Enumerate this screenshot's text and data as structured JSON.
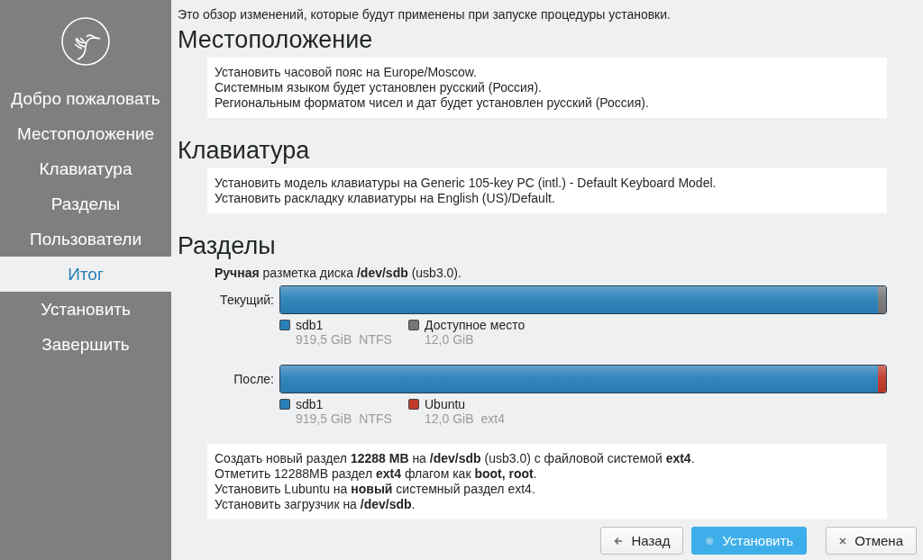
{
  "sidebar": {
    "items": [
      {
        "label": "Добро пожаловать",
        "selected": false
      },
      {
        "label": "Местоположение",
        "selected": false
      },
      {
        "label": "Клавиатура",
        "selected": false
      },
      {
        "label": "Разделы",
        "selected": false
      },
      {
        "label": "Пользователи",
        "selected": false
      },
      {
        "label": "Итог",
        "selected": true
      },
      {
        "label": "Установить",
        "selected": false
      },
      {
        "label": "Завершить",
        "selected": false
      }
    ]
  },
  "intro": "Это обзор изменений, которые будут применены при запуске процедуры установки.",
  "sections": [
    {
      "kind": "text",
      "title": "Местоположение",
      "lines": [
        "Установить часовой пояс на Europe/Moscow.",
        "Системным языком будет установлен русский (Россия).",
        "Региональным форматом чисел и дат будет установлен русский (Россия)."
      ]
    },
    {
      "kind": "text",
      "title": "Клавиатура",
      "lines": [
        "Установить модель клавиатуры на Generic 105-key PC (intl.) - Default Keyboard Model.",
        "Установить раскладку клавиатуры на English (US)/Default."
      ]
    },
    {
      "kind": "partitions",
      "title": "Разделы",
      "description": "**Ручная** разметка диска **/dev/sdb** (usb3.0).",
      "bars": [
        {
          "label": "Текущий:",
          "segments": [
            {
              "name": "sdb1",
              "size": "919,5 GiB",
              "filesystem": "NTFS",
              "color": "#2980b9",
              "level": 0.987
            },
            {
              "name": "Доступное место",
              "size": "12,0 GiB",
              "color": "#777777",
              "level": 0.013
            }
          ]
        },
        {
          "label": "После:",
          "segments": [
            {
              "name": "sdb1",
              "size": "919,5 GiB",
              "filesystem": "NTFS",
              "color": "#2980b9",
              "level": 0.987
            },
            {
              "name": "Ubuntu",
              "size": "12,0 GiB",
              "filesystem": "ext4",
              "color": "#c0392b",
              "level": 0.013
            }
          ]
        }
      ],
      "lines": [
        "Создать новый раздел **12288 MB** на **/dev/sdb** (usb3.0) с файловой системой **ext4**.",
        "Отметить 12288MB раздел **ext4** флагом как **boot, root**.",
        "Установить Lubuntu на **новый** системный раздел ext4.",
        "Установить загрузчик на **/dev/sdb**."
      ]
    }
  ],
  "buttons": [
    {
      "label": "Назад",
      "kind": "back",
      "default": false
    },
    {
      "label": "Установить",
      "kind": "install",
      "default": true
    },
    {
      "label": "Отмена",
      "kind": "cancel",
      "default": false
    }
  ]
}
